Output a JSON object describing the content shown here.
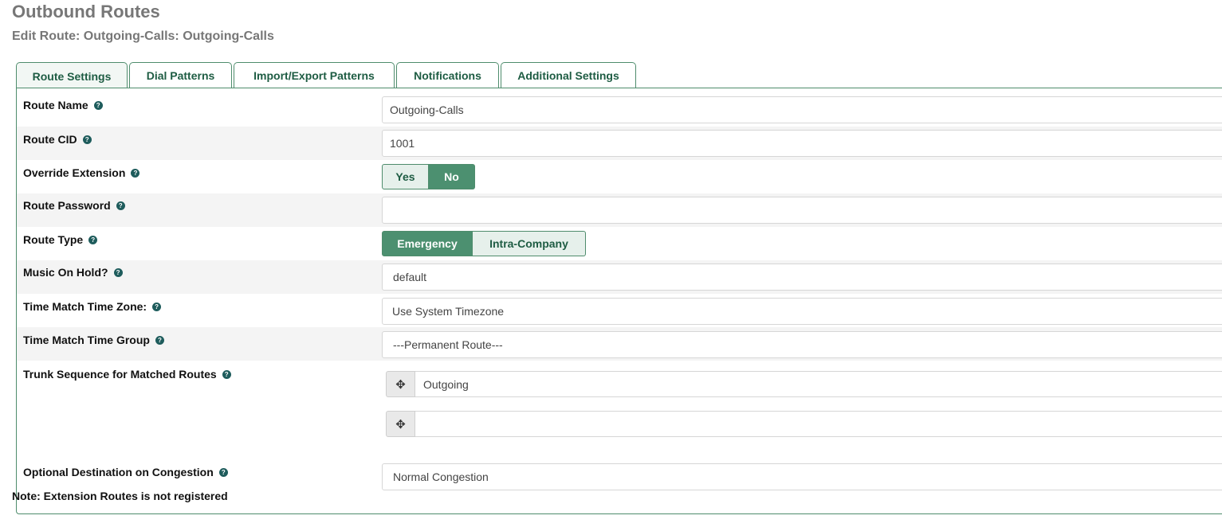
{
  "header": {
    "title": "Outbound Routes",
    "subtitle": "Edit Route: Outgoing-Calls: Outgoing-Calls"
  },
  "tabs": [
    {
      "label": "Route Settings",
      "active": true
    },
    {
      "label": "Dial Patterns",
      "active": false
    },
    {
      "label": "Import/Export Patterns",
      "active": false
    },
    {
      "label": "Notifications",
      "active": false
    },
    {
      "label": "Additional Settings",
      "active": false
    }
  ],
  "help_glyph": "?",
  "form": {
    "route_name": {
      "label": "Route Name",
      "value": "Outgoing-Calls"
    },
    "route_cid": {
      "label": "Route CID",
      "value": "1001"
    },
    "override_extension": {
      "label": "Override Extension",
      "options": [
        "Yes",
        "No"
      ],
      "selected": "No"
    },
    "route_password": {
      "label": "Route Password",
      "value": ""
    },
    "route_type": {
      "label": "Route Type",
      "options": [
        "Emergency",
        "Intra-Company"
      ],
      "selected": "Emergency"
    },
    "music_on_hold": {
      "label": "Music On Hold?",
      "value": "default"
    },
    "time_zone": {
      "label": "Time Match Time Zone:",
      "value": "Use System Timezone"
    },
    "time_group": {
      "label": "Time Match Time Group",
      "value": "---Permanent Route---"
    },
    "trunk_sequence": {
      "label": "Trunk Sequence for Matched Routes",
      "trunks": [
        "Outgoing",
        ""
      ],
      "handle_icon": "move-icon"
    },
    "congestion": {
      "label": "Optional Destination on Congestion",
      "value": "Normal Congestion"
    }
  },
  "note": "Note: Extension Routes is not registered",
  "colors": {
    "accent": "#4c9070",
    "tab_text": "#1e5c43",
    "border": "#4e8c6c"
  }
}
